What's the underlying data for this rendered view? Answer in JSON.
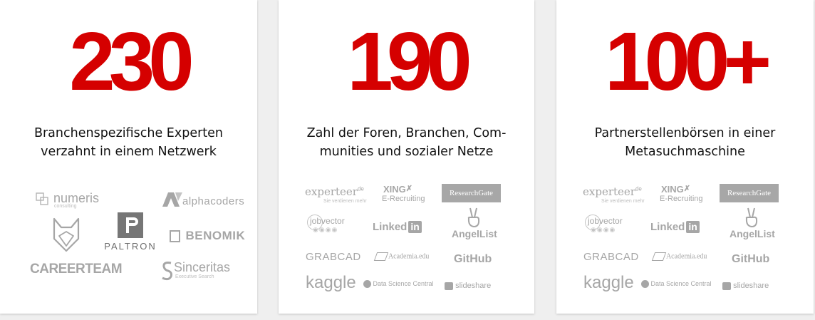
{
  "colors": {
    "accent": "#d50000",
    "logo_gray": "#a6a6a6"
  },
  "cards": [
    {
      "stat": "230",
      "description": [
        "Branchenspezifische Experten",
        "verzahnt in einem Netzwerk"
      ],
      "logos": {
        "numeris": "numeris",
        "numeris_sub": "consulting",
        "alphacoders": "alphacoders",
        "paltron": "PALTRON",
        "benomik": "BENOMIK",
        "careerteam": "CAREERTEAM",
        "sinceritas": "Sinceritas",
        "sinceritas_sub": "Executive Search"
      }
    },
    {
      "stat": "190",
      "description": [
        "Zahl der Foren, Branchen, Com-",
        "munities und sozialer Netze"
      ],
      "logos": {
        "experteer": "experteer",
        "experteer_sup": "de",
        "experteer_sub": "Sie verdienen mehr",
        "xing": "XING",
        "xing_sub": "E-Recruiting",
        "researchgate": "ResearchGate",
        "jobvector": "jobvector",
        "linkedin_a": "Linked",
        "linkedin_b": "in",
        "angellist": "AngelList",
        "grabcad": "GRABCAD",
        "academia": "Academia.edu",
        "github": "GitHub",
        "kaggle": "kaggle",
        "dsc": "Data Science Central",
        "slideshare": "slideshare"
      }
    },
    {
      "stat": "100+",
      "description": [
        "Partnerstellenbörsen in einer",
        "Metasuchmaschine"
      ],
      "logos": {
        "experteer": "experteer",
        "experteer_sup": "de",
        "experteer_sub": "Sie verdienen mehr",
        "xing": "XING",
        "xing_sub": "E-Recruiting",
        "researchgate": "ResearchGate",
        "jobvector": "jobvector",
        "linkedin_a": "Linked",
        "linkedin_b": "in",
        "angellist": "AngelList",
        "grabcad": "GRABCAD",
        "academia": "Academia.edu",
        "github": "GitHub",
        "kaggle": "kaggle",
        "dsc": "Data Science Central",
        "slideshare": "slideshare"
      }
    }
  ]
}
